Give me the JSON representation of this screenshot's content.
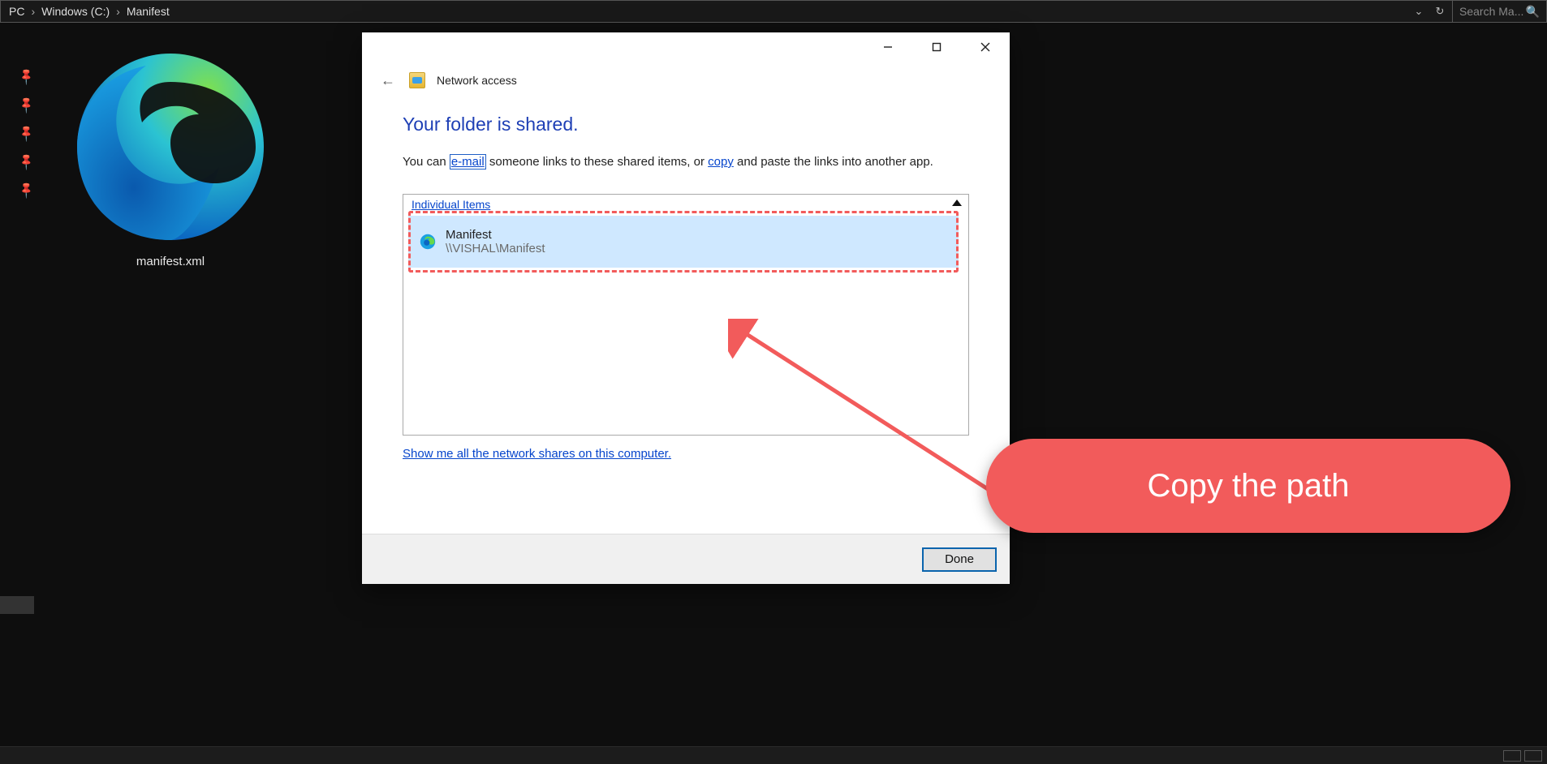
{
  "breadcrumbs": {
    "b0": "PC",
    "b1": "Windows (C:)",
    "b2": "Manifest"
  },
  "search": {
    "placeholder": "Search Ma..."
  },
  "file": {
    "label": "manifest.xml"
  },
  "dialog": {
    "title": "Network access",
    "heading": "Your folder is shared.",
    "para_pre": "You can ",
    "link_email": "e-mail",
    "para_mid": " someone links to these shared items, or ",
    "link_copy": "copy",
    "para_post": " and paste the links into another app.",
    "group_label": "Individual Items",
    "item_name": "Manifest",
    "item_path": "\\\\VISHAL\\Manifest",
    "shares_link": "Show me all the network shares on this computer.",
    "done": "Done"
  },
  "callout": {
    "text": "Copy the path"
  }
}
